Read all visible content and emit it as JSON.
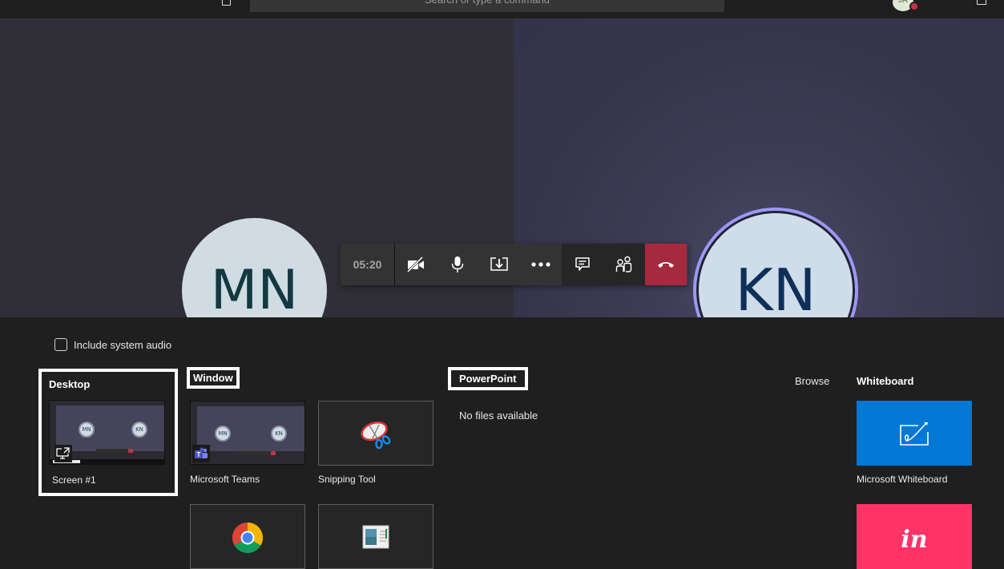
{
  "topbar": {
    "search_placeholder": "Search or type a command",
    "user_initials": "JA",
    "user_status_color": "#c4314b"
  },
  "participants": [
    {
      "initials": "MN",
      "speaking": false
    },
    {
      "initials": "KN",
      "speaking": true
    }
  ],
  "call_controls": {
    "timer": "05:20",
    "buttons": [
      {
        "name": "camera-off",
        "icon": "video-off-icon"
      },
      {
        "name": "microphone",
        "icon": "mic-icon"
      },
      {
        "name": "share",
        "icon": "share-tray-icon"
      },
      {
        "name": "more",
        "icon": "more-icon"
      },
      {
        "name": "chat",
        "icon": "chat-icon"
      },
      {
        "name": "participants",
        "icon": "people-icon"
      },
      {
        "name": "hang-up",
        "icon": "phone-hangup-icon"
      }
    ],
    "hangup_color": "#a52a3d"
  },
  "share_tray": {
    "include_audio_label": "Include system audio",
    "include_audio_checked": false,
    "desktop": {
      "title": "Desktop",
      "items": [
        {
          "label": "Screen #1"
        }
      ]
    },
    "window": {
      "title": "Window",
      "items": [
        {
          "label": "Microsoft Teams"
        },
        {
          "label": "Snipping Tool"
        },
        {
          "label": ""
        },
        {
          "label": ""
        }
      ]
    },
    "powerpoint": {
      "title": "PowerPoint",
      "empty_text": "No files available",
      "browse_label": "Browse"
    },
    "whiteboard": {
      "title": "Whiteboard",
      "items": [
        {
          "label": "Microsoft Whiteboard",
          "color": "#0078d4"
        },
        {
          "label": "",
          "color": "#ff3366",
          "glyph": "in"
        }
      ]
    }
  }
}
